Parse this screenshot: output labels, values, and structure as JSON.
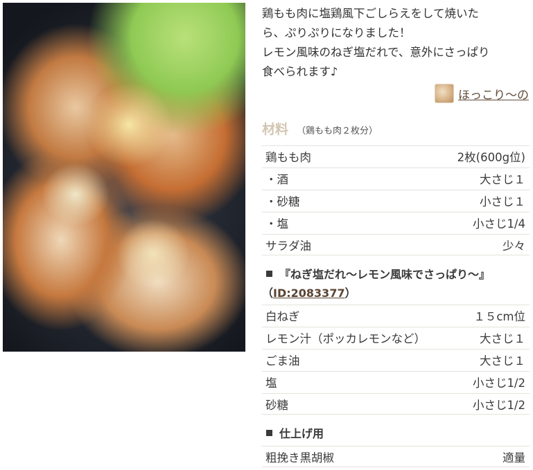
{
  "description": {
    "lines": [
      "鶏もも肉に塩鶏風下ごしらえをして焼いた",
      "ら、ぷりぷりになりました！",
      "レモン風味のねぎ塩だれで、意外にさっぱり",
      "食べられます♪"
    ]
  },
  "author": {
    "name": "ほっこり～の"
  },
  "ingredients_header": {
    "title": "材料",
    "servings": "（鶏もも肉２枚分）"
  },
  "ingredients": [
    {
      "name": "鶏もも肉",
      "qty": "2枚(600g位)"
    },
    {
      "name": "・酒",
      "qty": "大さじ１"
    },
    {
      "name": "・砂糖",
      "qty": "小さじ１"
    },
    {
      "name": "・塩",
      "qty": "小さじ1/4"
    },
    {
      "name": "サラダ油",
      "qty": "少々"
    }
  ],
  "sauce_section": {
    "title": "『ねぎ塩だれ～レモン風味でさっぱり～』",
    "id_open": "（",
    "id_label": "ID:2083377",
    "id_close": "）"
  },
  "sauce_ingredients": [
    {
      "name": "白ねぎ",
      "qty": "１５cm位"
    },
    {
      "name": "レモン汁（ポッカレモンなど）",
      "qty": "大さじ１"
    },
    {
      "name": "ごま油",
      "qty": "大さじ１"
    },
    {
      "name": "塩",
      "qty": "小さじ1/2"
    },
    {
      "name": "砂糖",
      "qty": "小さじ1/2"
    }
  ],
  "finish_section": {
    "title": "仕上げ用"
  },
  "finish_ingredients": [
    {
      "name": "粗挽き黒胡椒",
      "qty": "適量"
    }
  ]
}
